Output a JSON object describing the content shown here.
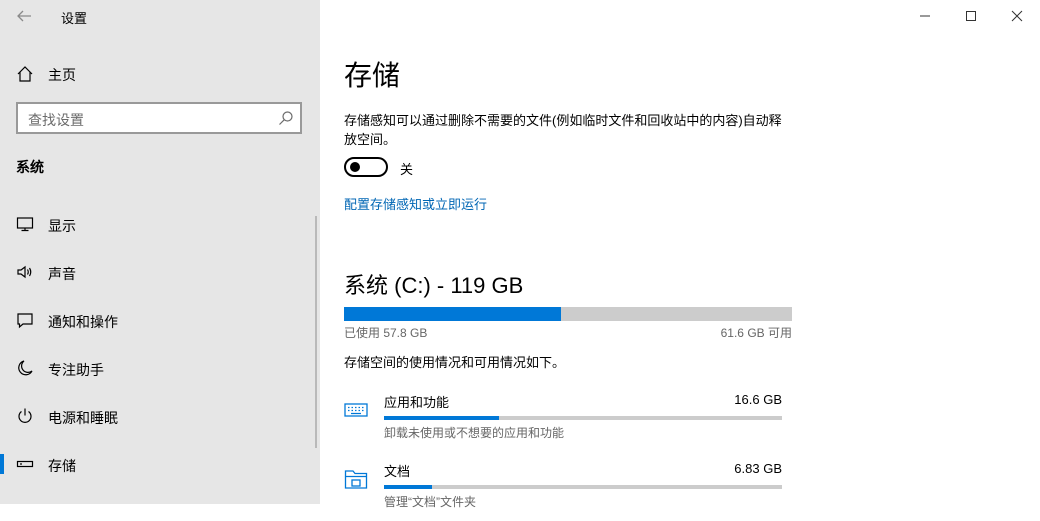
{
  "app": {
    "title": "设置"
  },
  "sidebar": {
    "home_label": "主页",
    "search_placeholder": "查找设置",
    "section": "系统",
    "items": [
      {
        "label": "显示",
        "icon": "monitor-icon"
      },
      {
        "label": "声音",
        "icon": "speaker-icon"
      },
      {
        "label": "通知和操作",
        "icon": "notification-icon"
      },
      {
        "label": "专注助手",
        "icon": "moon-icon"
      },
      {
        "label": "电源和睡眠",
        "icon": "power-icon"
      },
      {
        "label": "存储",
        "icon": "storage-icon",
        "selected": true
      }
    ]
  },
  "main": {
    "title": "存储",
    "description": "存储感知可以通过删除不需要的文件(例如临时文件和回收站中的内容)自动释放空间。",
    "toggle": {
      "state": "off",
      "label": "关"
    },
    "link": "配置存储感知或立即运行",
    "drive": {
      "title": "系统 (C:) - 119 GB",
      "used": "已使用 57.8 GB",
      "free": "61.6 GB 可用",
      "used_fraction": 0.484
    },
    "usage_description": "存储空间的使用情况和可用情况如下。",
    "categories": [
      {
        "name": "应用和功能",
        "size": "16.6 GB",
        "sub": "卸载未使用或不想要的应用和功能",
        "fraction": 0.29,
        "icon": "apps-keyboard-icon"
      },
      {
        "name": "文档",
        "size": "6.83 GB",
        "sub": "管理“文档”文件夹",
        "fraction": 0.12,
        "icon": "folder-icon"
      }
    ]
  },
  "colors": {
    "accent": "#0078d7",
    "sidebar_bg": "#e6e6e6",
    "link": "#0066b4"
  }
}
